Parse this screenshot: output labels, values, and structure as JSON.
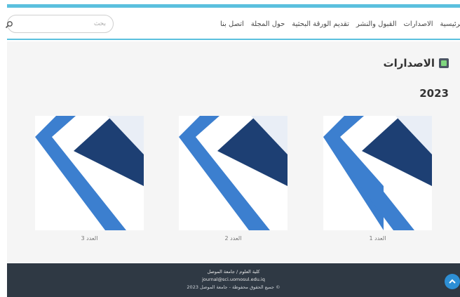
{
  "nav": {
    "items": [
      "الرئيسية",
      "الاصدارات",
      "القبول والنشر",
      "تقديم الورقة البحثية",
      "حول المجلة",
      "اتصل بنا"
    ],
    "search_placeholder": "بحث"
  },
  "page": {
    "section_title": "الاصدارات",
    "year": "2023"
  },
  "issues": [
    {
      "caption": "العدد 1"
    },
    {
      "caption": "العدد 2"
    },
    {
      "caption": "العدد 3"
    }
  ],
  "footer": {
    "line1": "كلية العلوم / جامعة الموصل",
    "line2": "journal@sci.uomosul.edu.iq",
    "line3": "© جميع الحقوق محفوظة - جامعة الموصل 2023"
  },
  "colors": {
    "accent": "#5bc0de",
    "cover_dark": "#1d3f73",
    "cover_light": "#3c7fcf",
    "footer": "#2f3944",
    "fab": "#2d8fd5"
  },
  "icons": {
    "search": "search-icon",
    "section": "book-icon",
    "fab": "scroll-up-icon"
  }
}
